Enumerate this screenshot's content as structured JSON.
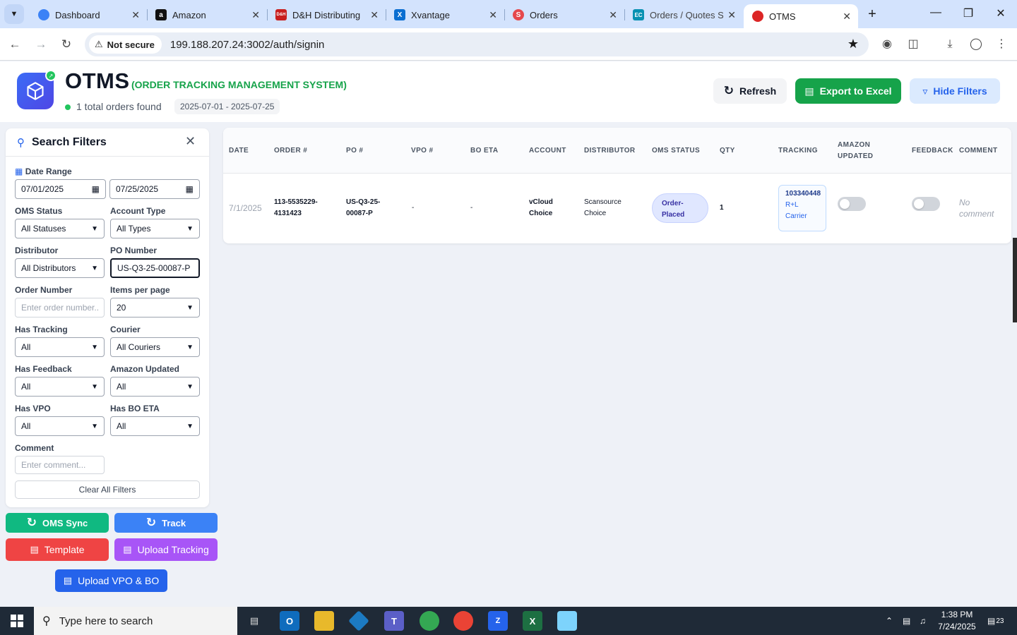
{
  "browser": {
    "tabs": [
      {
        "title": "Dashboard",
        "icon": "globe-icon",
        "color": "#3b82f6"
      },
      {
        "title": "Amazon",
        "icon": "amazon-icon",
        "color": "#111111"
      },
      {
        "title": "D&H Distributing",
        "icon": "dh-icon",
        "color": "#c81e1e"
      },
      {
        "title": "Xvantage",
        "icon": "xvantage-icon",
        "color": "#0a6ed1"
      },
      {
        "title": "Orders",
        "icon": "orders-icon",
        "color": "#e5484d"
      },
      {
        "title": "Orders / Quotes S",
        "icon": "ec-icon",
        "color": "#0891b2"
      },
      {
        "title": "OTMS",
        "icon": "otms-icon",
        "color": "#dc2626"
      }
    ],
    "security_label": "Not secure",
    "url": "199.188.207.24:3002/auth/signin"
  },
  "header": {
    "title": "OTMS",
    "subtitle": "(ORDER TRACKING MANAGEMENT SYSTEM)",
    "orders_count": "1 total orders found",
    "date_range": "2025-07-01 - 2025-07-25",
    "refresh_label": "Refresh",
    "export_label": "Export to Excel",
    "hide_filters_label": "Hide Filters"
  },
  "filters": {
    "title": "Search Filters",
    "date_range_label": "Date Range",
    "date_from": "07/01/2025",
    "date_to": "07/25/2025",
    "oms_status_label": "OMS Status",
    "oms_status_value": "All Statuses",
    "account_type_label": "Account Type",
    "account_type_value": "All Types",
    "distributor_label": "Distributor",
    "distributor_value": "All Distributors",
    "po_number_label": "PO Number",
    "po_number_value": "US-Q3-25-00087-P",
    "order_number_label": "Order Number",
    "order_number_placeholder": "Enter order number...",
    "items_per_page_label": "Items per page",
    "items_per_page_value": "20",
    "has_tracking_label": "Has Tracking",
    "has_tracking_value": "All",
    "courier_label": "Courier",
    "courier_value": "All Couriers",
    "has_feedback_label": "Has Feedback",
    "has_feedback_value": "All",
    "amazon_updated_label": "Amazon Updated",
    "amazon_updated_value": "All",
    "has_vpo_label": "Has VPO",
    "has_vpo_value": "All",
    "has_bo_eta_label": "Has BO ETA",
    "has_bo_eta_value": "All",
    "comment_label": "Comment",
    "comment_placeholder": "Enter comment...",
    "clear_label": "Clear All Filters"
  },
  "actions": {
    "oms_sync": "OMS Sync",
    "track": "Track",
    "template": "Template",
    "upload_tracking": "Upload Tracking",
    "upload_vpo_bo": "Upload VPO & BO"
  },
  "table": {
    "headers": {
      "date": "DATE",
      "order": "ORDER #",
      "po": "PO #",
      "vpo": "VPO #",
      "bo_eta": "BO ETA",
      "account": "ACCOUNT",
      "distributor": "DISTRIBUTOR",
      "oms_status": "OMS STATUS",
      "qty": "QTY",
      "tracking": "TRACKING",
      "amazon_updated_1": "AMAZON",
      "amazon_updated_2": "UPDATED",
      "feedback": "FEEDBACK",
      "comment": "COMMENT"
    },
    "row": {
      "date": "7/1/2025",
      "order_1": "113-5535229-",
      "order_2": "4131423",
      "po_1": "US-Q3-25-",
      "po_2": "00087-P",
      "vpo": "-",
      "bo_eta": "-",
      "account_1": "vCloud",
      "account_2": "Choice",
      "distributor_1": "Scansource",
      "distributor_2": "Choice",
      "oms_status_1": "Order-",
      "oms_status_2": "Placed",
      "qty": "1",
      "tracking_number": "103340448",
      "tracking_carrier_1": "R+L",
      "tracking_carrier_2": "Carrier",
      "amazon_updated": false,
      "feedback": false,
      "comment_1": "No",
      "comment_2": "comment"
    }
  },
  "taskbar": {
    "search_placeholder": "Type here to search",
    "time": "1:38 PM",
    "date": "7/24/2025",
    "notifications": "23"
  }
}
